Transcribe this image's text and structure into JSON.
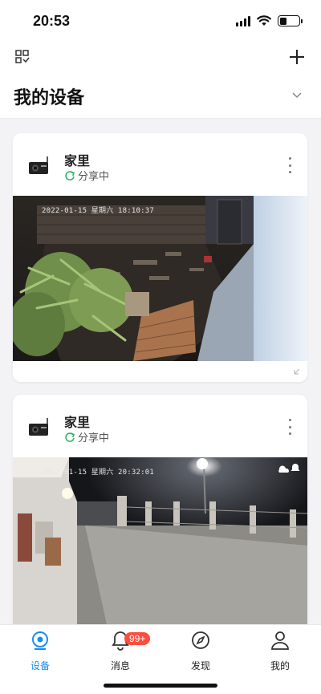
{
  "status_bar": {
    "time": "20:53",
    "battery_level": 0.35
  },
  "header": {
    "title": "我的设备"
  },
  "devices": [
    {
      "name": "家里",
      "share_status": "分享中",
      "timestamp": "2022-01-15 星期六 18:10:37"
    },
    {
      "name": "家里",
      "share_status": "分享中",
      "timestamp": "2022-01-15 星期六 20:32:01"
    }
  ],
  "nav": {
    "items": [
      {
        "label": "设备",
        "icon": "device-icon",
        "active": true
      },
      {
        "label": "消息",
        "icon": "bell-icon",
        "badge": "99+"
      },
      {
        "label": "发现",
        "icon": "compass-icon"
      },
      {
        "label": "我的",
        "icon": "user-icon"
      }
    ]
  },
  "colors": {
    "accent": "#1a8cf0",
    "badge": "#ff4d3d",
    "share": "#2ab56a"
  }
}
